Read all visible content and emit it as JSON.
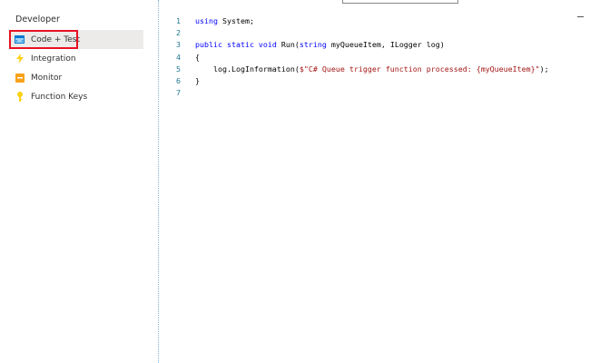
{
  "sidebar": {
    "section_title": "Developer",
    "items": [
      {
        "label": "Code + Test",
        "icon": "code-test-icon",
        "selected": true
      },
      {
        "label": "Integration",
        "icon": "lightning-bolt-icon",
        "selected": false
      },
      {
        "label": "Monitor",
        "icon": "monitor-icon",
        "selected": false
      },
      {
        "label": "Function Keys",
        "icon": "key-icon",
        "selected": false
      }
    ]
  },
  "editor": {
    "lines": [
      {
        "num": "1",
        "tokens": [
          {
            "t": "using",
            "c": "kw"
          },
          {
            "t": " System;",
            "c": ""
          }
        ]
      },
      {
        "num": "2",
        "tokens": []
      },
      {
        "num": "3",
        "tokens": [
          {
            "t": "public static void",
            "c": "kw"
          },
          {
            "t": " Run(",
            "c": ""
          },
          {
            "t": "string",
            "c": "kw"
          },
          {
            "t": " myQueueItem, ILogger log)",
            "c": ""
          }
        ]
      },
      {
        "num": "4",
        "tokens": [
          {
            "t": "{",
            "c": ""
          }
        ]
      },
      {
        "num": "5",
        "tokens": [
          {
            "t": "    log.LogInformation(",
            "c": ""
          },
          {
            "t": "$\"C# Queue trigger function processed: {myQueueItem}\"",
            "c": "str"
          },
          {
            "t": ");",
            "c": ""
          }
        ]
      },
      {
        "num": "6",
        "tokens": [
          {
            "t": "}",
            "c": ""
          }
        ]
      },
      {
        "num": "7",
        "tokens": []
      }
    ]
  },
  "colors": {
    "accent_highlight": "#e81123",
    "keyword": "#0000ff",
    "string": "#a31515",
    "line_number": "#237893",
    "selected_bg": "#edebe9"
  }
}
